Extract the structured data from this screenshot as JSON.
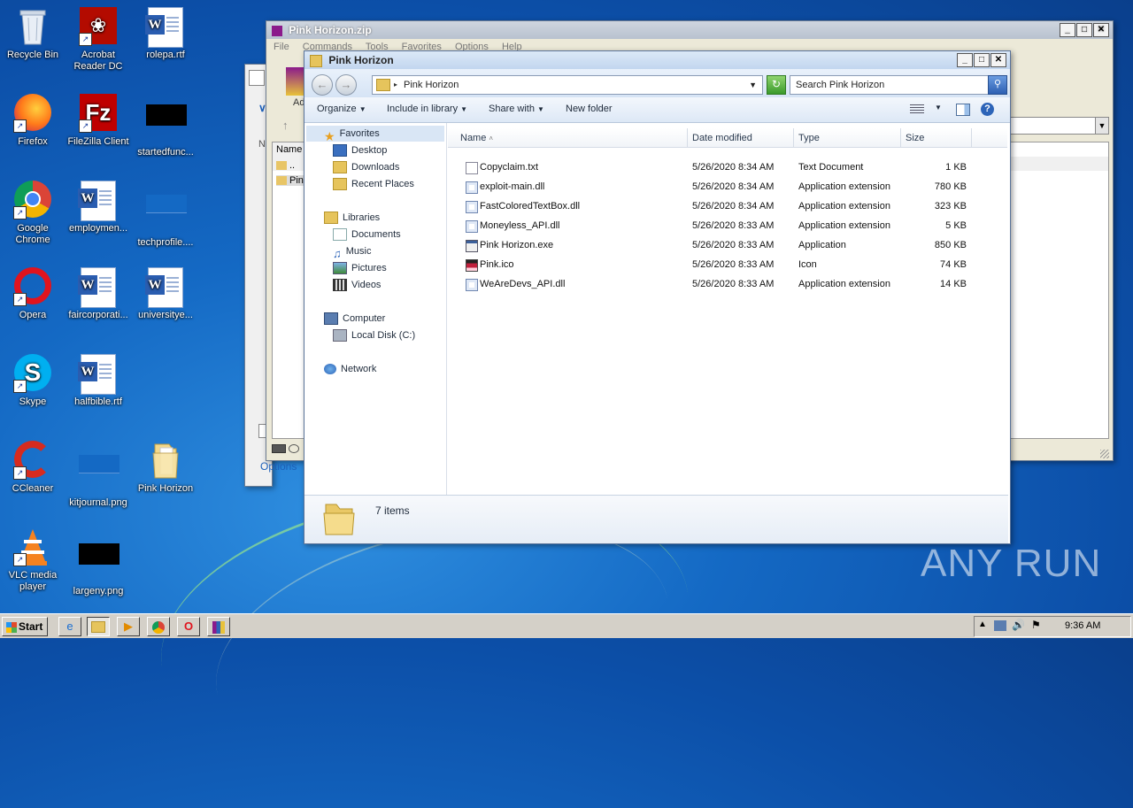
{
  "desktop": {
    "icons": [
      {
        "label": "Recycle Bin"
      },
      {
        "label": "Acrobat Reader DC"
      },
      {
        "label": "rolepa.rtf"
      },
      {
        "label": "Firefox"
      },
      {
        "label": "FileZilla Client"
      },
      {
        "label": "startedfunc..."
      },
      {
        "label": "Google Chrome"
      },
      {
        "label": "employmen..."
      },
      {
        "label": "techprofile...."
      },
      {
        "label": "Opera"
      },
      {
        "label": "faircorporati..."
      },
      {
        "label": "universitye..."
      },
      {
        "label": "Skype"
      },
      {
        "label": "halfbible.rtf"
      },
      {
        "label": "CCleaner"
      },
      {
        "label": "kitjournal.png"
      },
      {
        "label": "Pink Horizon"
      },
      {
        "label": "VLC media player"
      },
      {
        "label": "largeny.png"
      }
    ]
  },
  "winrar": {
    "title": "Pink Horizon.zip",
    "menu": [
      "File",
      "Commands",
      "Tools",
      "Favorites",
      "Options",
      "Help"
    ],
    "name_col": "Name",
    "row_dotdot": "..",
    "row_pin": "Pin",
    "options_link": "Options"
  },
  "behind_window": {
    "label_n": "N"
  },
  "explorer": {
    "title": "Pink Horizon",
    "breadcrumb": "Pink Horizon",
    "search_placeholder": "Search Pink Horizon",
    "toolbar": {
      "organize": "Organize",
      "include": "Include in library",
      "share": "Share with",
      "new_folder": "New folder"
    },
    "nav": {
      "favorites": "Favorites",
      "desktop": "Desktop",
      "downloads": "Downloads",
      "recent": "Recent Places",
      "libraries": "Libraries",
      "documents": "Documents",
      "music": "Music",
      "pictures": "Pictures",
      "videos": "Videos",
      "computer": "Computer",
      "localdisk": "Local Disk (C:)",
      "network": "Network"
    },
    "columns": {
      "name": "Name",
      "date": "Date modified",
      "type": "Type",
      "size": "Size"
    },
    "files": [
      {
        "name": "Copyclaim.txt",
        "date": "5/26/2020 8:34 AM",
        "type": "Text Document",
        "size": "1 KB",
        "icon": "text-file-icon"
      },
      {
        "name": "exploit-main.dll",
        "date": "5/26/2020 8:34 AM",
        "type": "Application extension",
        "size": "780 KB",
        "icon": "dll-file-icon"
      },
      {
        "name": "FastColoredTextBox.dll",
        "date": "5/26/2020 8:34 AM",
        "type": "Application extension",
        "size": "323 KB",
        "icon": "dll-file-icon"
      },
      {
        "name": "Moneyless_API.dll",
        "date": "5/26/2020 8:33 AM",
        "type": "Application extension",
        "size": "5 KB",
        "icon": "dll-file-icon"
      },
      {
        "name": "Pink Horizon.exe",
        "date": "5/26/2020 8:33 AM",
        "type": "Application",
        "size": "850 KB",
        "icon": "exe-file-icon"
      },
      {
        "name": "Pink.ico",
        "date": "5/26/2020 8:33 AM",
        "type": "Icon",
        "size": "74 KB",
        "icon": "ico-file-icon"
      },
      {
        "name": "WeAreDevs_API.dll",
        "date": "5/26/2020 8:33 AM",
        "type": "Application extension",
        "size": "14 KB",
        "icon": "dll-file-icon"
      }
    ],
    "status": "7 items"
  },
  "taskbar": {
    "start": "Start",
    "clock": "9:36 AM"
  },
  "watermark": "ANY RUN",
  "colors": {
    "accent": "#1c5fb8",
    "taskbar": "#d4d0c8"
  }
}
